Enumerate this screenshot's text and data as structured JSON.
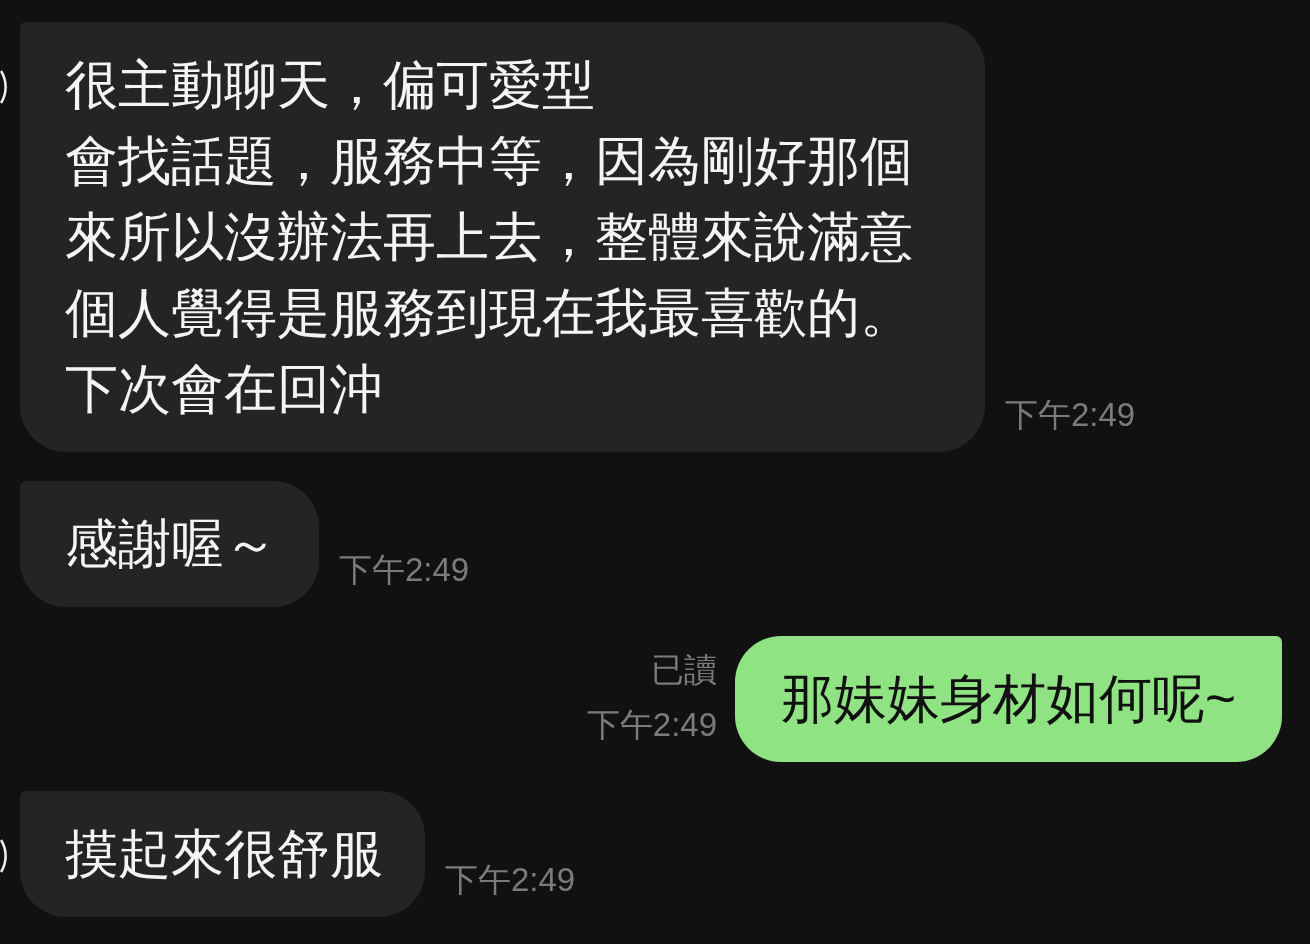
{
  "messages": [
    {
      "kind": "incoming",
      "show_avatar": true,
      "lines": [
        "很主動聊天，偏可愛型",
        "會找話題，服務中等，因為剛好那個",
        "來所以沒辦法再上去，整體來說滿意",
        "個人覺得是服務到現在我最喜歡的。",
        "下次會在回沖"
      ],
      "time": "下午2:49"
    },
    {
      "kind": "incoming",
      "show_avatar": false,
      "lines": [
        "感謝喔～"
      ],
      "time": "下午2:49"
    },
    {
      "kind": "outgoing",
      "read_label": "已讀",
      "lines": [
        "那妹妹身材如何呢~"
      ],
      "time": "下午2:49"
    },
    {
      "kind": "incoming",
      "show_avatar": true,
      "lines": [
        "摸起來很舒服"
      ],
      "time": "下午2:49"
    }
  ]
}
